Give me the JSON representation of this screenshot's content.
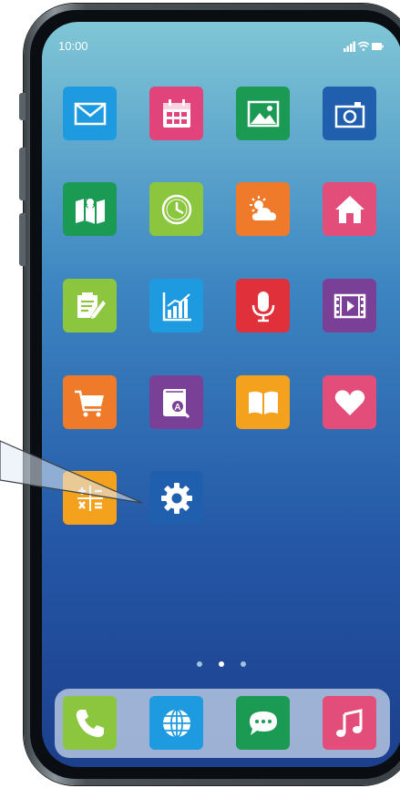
{
  "status_bar": {
    "time": "10:00"
  },
  "apps": [
    {
      "name": "mail",
      "icon": "envelope-icon",
      "color": "#1e9be0"
    },
    {
      "name": "calendar",
      "icon": "calendar-icon",
      "color": "#e0447a"
    },
    {
      "name": "photos",
      "icon": "image-icon",
      "color": "#1a9a52"
    },
    {
      "name": "camera",
      "icon": "camera-icon",
      "color": "#1f5fae"
    },
    {
      "name": "maps",
      "icon": "map-icon",
      "color": "#1a9a52"
    },
    {
      "name": "clock",
      "icon": "clock-icon",
      "color": "#8cc63f"
    },
    {
      "name": "weather",
      "icon": "weather-icon",
      "color": "#ef7a2a"
    },
    {
      "name": "home",
      "icon": "house-icon",
      "color": "#e24d7a"
    },
    {
      "name": "notes",
      "icon": "notes-icon",
      "color": "#8cc63f"
    },
    {
      "name": "stocks",
      "icon": "chart-icon",
      "color": "#1e9be0"
    },
    {
      "name": "voice-memos",
      "icon": "microphone-icon",
      "color": "#e0303a"
    },
    {
      "name": "videos",
      "icon": "film-icon",
      "color": "#7a3f96"
    },
    {
      "name": "shopping",
      "icon": "cart-icon",
      "color": "#ef7a2a"
    },
    {
      "name": "dictionary",
      "icon": "book-search-icon",
      "color": "#7a3f96"
    },
    {
      "name": "books",
      "icon": "open-book-icon",
      "color": "#f4a21d"
    },
    {
      "name": "health",
      "icon": "heart-icon",
      "color": "#e24d7a"
    },
    {
      "name": "calculator",
      "icon": "calculator-icon",
      "color": "#f4a21d"
    },
    {
      "name": "settings",
      "icon": "gear-icon",
      "color": "#1f5fae"
    }
  ],
  "page_indicator": {
    "pages": 3,
    "current": 2
  },
  "dock": [
    {
      "name": "phone",
      "icon": "phone-icon",
      "color": "#8cc63f"
    },
    {
      "name": "browser",
      "icon": "globe-icon",
      "color": "#1e9be0"
    },
    {
      "name": "messages",
      "icon": "chat-icon",
      "color": "#1a9a52"
    },
    {
      "name": "music",
      "icon": "music-note-icon",
      "color": "#e24d7a"
    }
  ]
}
